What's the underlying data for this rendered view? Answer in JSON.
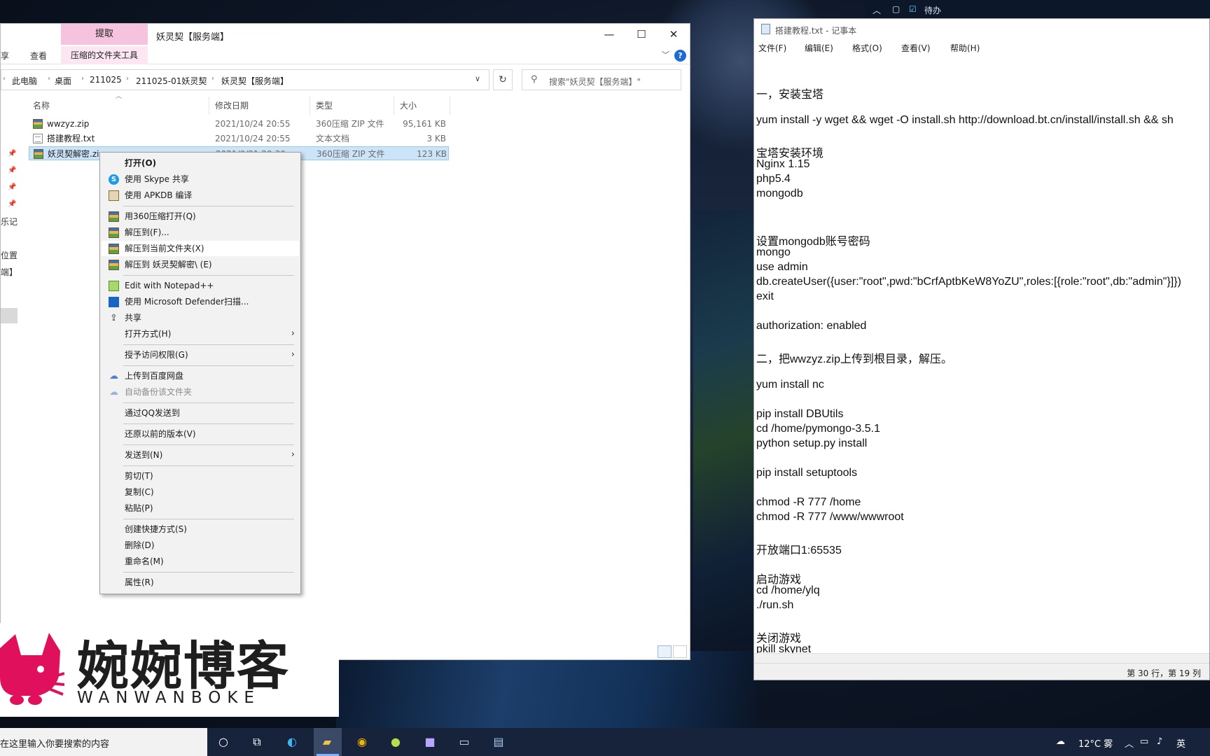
{
  "topbar": {
    "todo_label": "待办"
  },
  "explorer": {
    "ribbon_context_tab": "提取",
    "window_title": "妖灵契【服务端】",
    "ribbon_tabs": [
      "享",
      "查看"
    ],
    "ribbon_context_subtab": "压缩的文件夹工具",
    "breadcrumb": [
      "此电脑",
      "桌面",
      "211025",
      "211025-01妖灵契",
      "妖灵契【服务端】"
    ],
    "search_placeholder": "搜索\"妖灵契【服务端】\"",
    "columns": {
      "name": "名称",
      "date": "修改日期",
      "type": "类型",
      "size": "大小"
    },
    "files": [
      {
        "name": "wwzyz.zip",
        "date": "2021/10/24 20:55",
        "type": "360压缩 ZIP 文件",
        "size": "95,161 KB",
        "icon": "zip-icon"
      },
      {
        "name": "搭建教程.txt",
        "date": "2021/10/24 20:55",
        "type": "文本文档",
        "size": "3 KB",
        "icon": "txt-icon"
      },
      {
        "name": "妖灵契解密.zip",
        "date": "2021/9/21 20:30",
        "type": "360压缩 ZIP 文件",
        "size": "123 KB",
        "icon": "zip-icon"
      }
    ],
    "nav_fragments": [
      "乐记",
      "位置",
      "端】"
    ]
  },
  "context_menu": {
    "items": [
      {
        "label": "打开(O)",
        "bold": true
      },
      {
        "label": "使用 Skype 共享",
        "icon": "skype-icon"
      },
      {
        "label": "使用 APKDB 编译",
        "icon": "apkdb-icon"
      },
      {
        "label": "用360压缩打开(Q)",
        "icon": "zip-icon"
      },
      {
        "label": "解压到(F)...",
        "icon": "zip-icon"
      },
      {
        "label": "解压到当前文件夹(X)",
        "icon": "zip-icon"
      },
      {
        "label": "解压到 妖灵契解密\\ (E)",
        "icon": "zip-icon"
      },
      {
        "label": "Edit with Notepad++",
        "icon": "notepad-plus-plus-icon"
      },
      {
        "label": "使用 Microsoft Defender扫描...",
        "icon": "defender-shield-icon"
      },
      {
        "label": "共享",
        "icon": "share-icon"
      },
      {
        "label": "打开方式(H)",
        "submenu": true
      },
      {
        "label": "授予访问权限(G)",
        "submenu": true
      },
      {
        "label": "上传到百度网盘",
        "icon": "baidu-cloud-icon"
      },
      {
        "label": "自动备份该文件夹",
        "icon": "baidu-cloud-icon",
        "disabled": true
      },
      {
        "label": "通过QQ发送到"
      },
      {
        "label": "还原以前的版本(V)"
      },
      {
        "label": "发送到(N)",
        "submenu": true
      },
      {
        "label": "剪切(T)"
      },
      {
        "label": "复制(C)"
      },
      {
        "label": "粘贴(P)"
      },
      {
        "label": "创建快捷方式(S)"
      },
      {
        "label": "删除(D)"
      },
      {
        "label": "重命名(M)"
      },
      {
        "label": "属性(R)"
      }
    ]
  },
  "notepad": {
    "title": "搭建教程.txt - 记事本",
    "menu": [
      "文件(F)",
      "编辑(E)",
      "格式(O)",
      "查看(V)",
      "帮助(H)"
    ],
    "lines": [
      "",
      "",
      "一，安装宝塔",
      "",
      "yum install -y wget && wget -O install.sh http://download.bt.cn/install/install.sh && sh",
      "",
      "宝塔安装环境",
      "Nginx 1.15",
      "php5.4",
      "mongodb",
      "",
      "",
      "设置mongodb账号密码",
      "mongo",
      "use admin",
      "db.createUser({user:\"root\",pwd:\"bCrfAptbKeW8YoZU\",roles:[{role:\"root\",db:\"admin\"}]})",
      "exit",
      "",
      "authorization: enabled",
      "",
      "二，把wwzyz.zip上传到根目录，解压。",
      "",
      "yum install nc",
      "",
      "pip install DBUtils",
      "cd /home/pymongo-3.5.1",
      "python setup.py install",
      "",
      "pip install setuptools",
      "",
      "chmod -R 777 /home",
      "chmod -R 777 /www/wwwroot",
      "",
      "开放端口1:65535",
      "",
      "启动游戏",
      "cd /home/ylq",
      "./run.sh",
      "",
      "关闭游戏",
      "pkill skynet"
    ],
    "status": "第 30 行，第 19 列"
  },
  "watermark": {
    "title": "婉婉博客",
    "subtitle": "WANWANBOKE",
    "accent": "#e0105c"
  },
  "taskbar": {
    "search_text": "在这里输入你要搜索的内容",
    "weather": "12°C 雾",
    "ime": "英"
  }
}
